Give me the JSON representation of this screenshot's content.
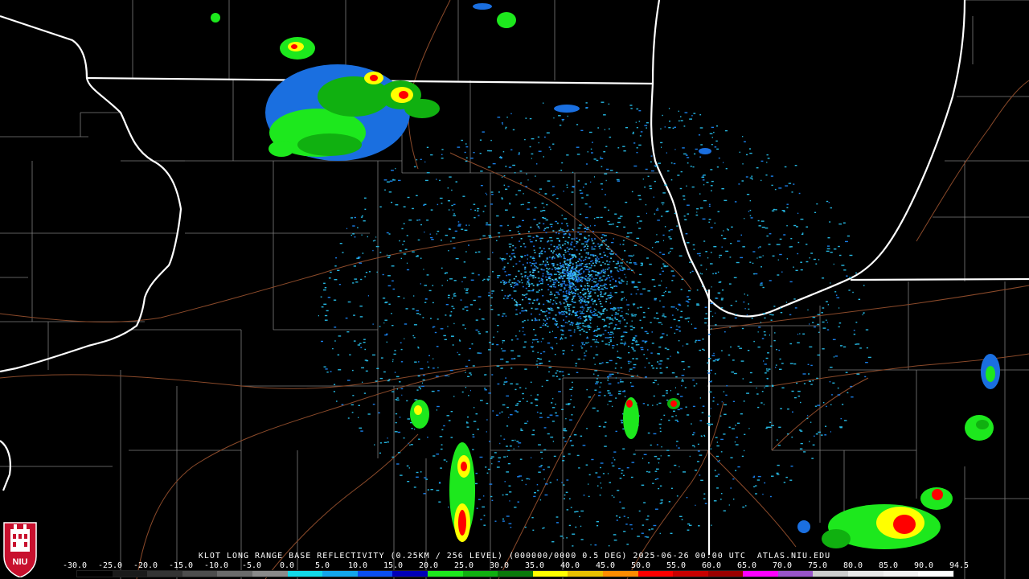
{
  "product_title": "KLOT LONG RANGE BASE REFLECTIVITY (0.25KM / 256 LEVEL) (000000/0000 0.5 DEG) 2025-06-26 00:00 UTC  ATLAS.NIU.EDU",
  "logo_text": "NIU",
  "scale": {
    "labels": [
      "-30.0",
      "-25.0",
      "-20.0",
      "-15.0",
      "-10.0",
      "-5.0",
      "0.0",
      "5.0",
      "10.0",
      "15.0",
      "20.0",
      "25.0",
      "30.0",
      "35.0",
      "40.0",
      "45.0",
      "50.0",
      "55.0",
      "60.0",
      "65.0",
      "70.0",
      "75.0",
      "80.0",
      "85.0",
      "90.0",
      "94.5"
    ],
    "colors": [
      "#000000",
      "#1a1a1a",
      "#333333",
      "#4d4d4d",
      "#6b6b6b",
      "#8a8a8a",
      "#12d8e8",
      "#13a6ec",
      "#0a4ff0",
      "#0000b8",
      "#1de81d",
      "#10b010",
      "#0a7a0a",
      "#ffff00",
      "#e8c000",
      "#ff8c00",
      "#ff0000",
      "#c80000",
      "#9a0000",
      "#ff00ff",
      "#9955c9",
      "#cccccc",
      "#e8e8e8",
      "#f2f2f2",
      "#ffffff"
    ]
  },
  "colors": {
    "state_border": "#ffffff",
    "county_border": "#8a8a8a",
    "highway": "#8b4a2a",
    "clutter": "#25b6e0"
  }
}
